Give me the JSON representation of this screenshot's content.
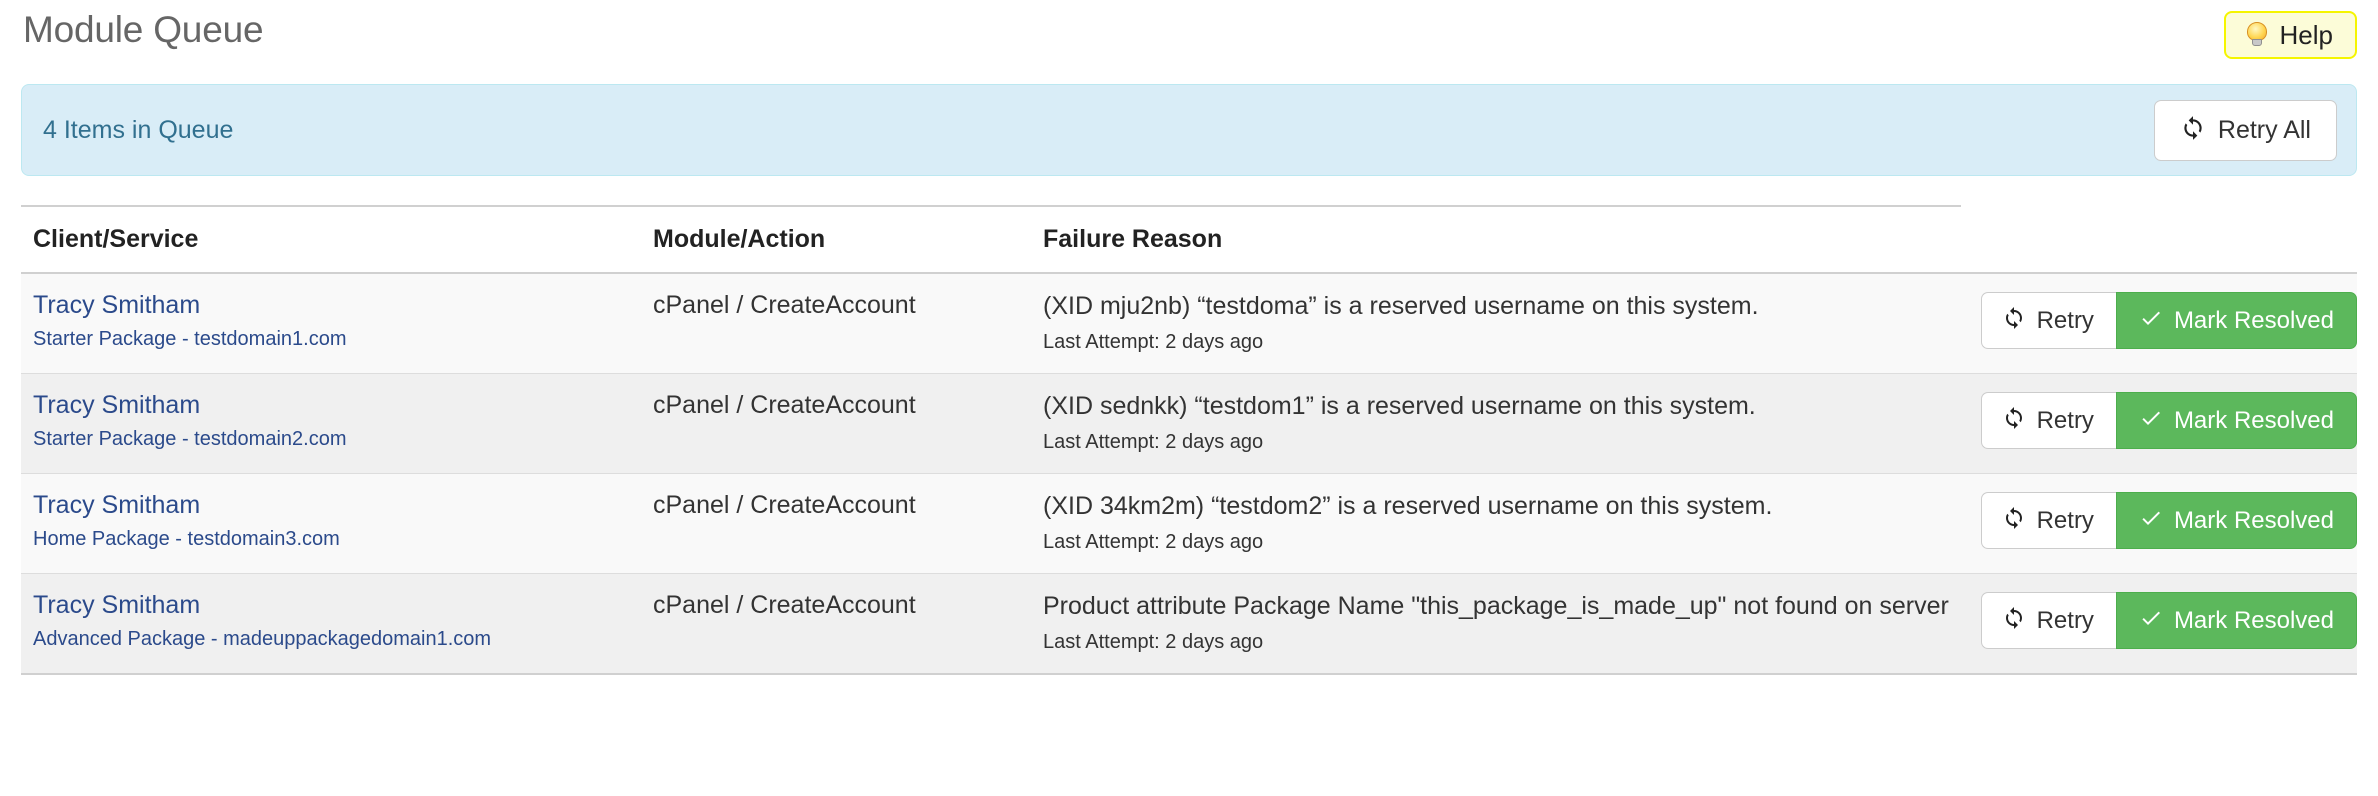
{
  "header": {
    "title": "Module Queue",
    "help_label": "Help",
    "help_icon": "lightbulb-icon"
  },
  "alert": {
    "message": "4 Items in Queue",
    "retry_all_label": "Retry All",
    "retry_all_icon": "refresh-icon",
    "background_color": "#d9edf7",
    "text_color": "#31708f"
  },
  "table": {
    "columns": [
      "Client/Service",
      "Module/Action",
      "Failure Reason",
      ""
    ],
    "rows": [
      {
        "client": "Tracy Smitham",
        "service": "Starter Package - testdomain1.com",
        "module_action": "cPanel / CreateAccount",
        "failure_reason": "(XID mju2nb) “testdoma” is a reserved username on this system.",
        "last_attempt": "Last Attempt: 2 days ago",
        "retry_label": "Retry",
        "resolve_label": "Mark Resolved"
      },
      {
        "client": "Tracy Smitham",
        "service": "Starter Package - testdomain2.com",
        "module_action": "cPanel / CreateAccount",
        "failure_reason": "(XID sednkk) “testdom1” is a reserved username on this system.",
        "last_attempt": "Last Attempt: 2 days ago",
        "retry_label": "Retry",
        "resolve_label": "Mark Resolved"
      },
      {
        "client": "Tracy Smitham",
        "service": "Home Package - testdomain3.com",
        "module_action": "cPanel / CreateAccount",
        "failure_reason": "(XID 34km2m) “testdom2” is a reserved username on this system.",
        "last_attempt": "Last Attempt: 2 days ago",
        "retry_label": "Retry",
        "resolve_label": "Mark Resolved"
      },
      {
        "client": "Tracy Smitham",
        "service": "Advanced Package - madeuppackagedomain1.com",
        "module_action": "cPanel / CreateAccount",
        "failure_reason": "Product attribute Package Name \"this_package_is_made_up\" not found on server",
        "last_attempt": "Last Attempt: 2 days ago",
        "retry_label": "Retry",
        "resolve_label": "Mark Resolved"
      }
    ]
  },
  "colors": {
    "success_green": "#5cb85c",
    "link_blue": "#2b4a8b",
    "help_yellow": "#f5f500",
    "title_gray": "#666666"
  }
}
